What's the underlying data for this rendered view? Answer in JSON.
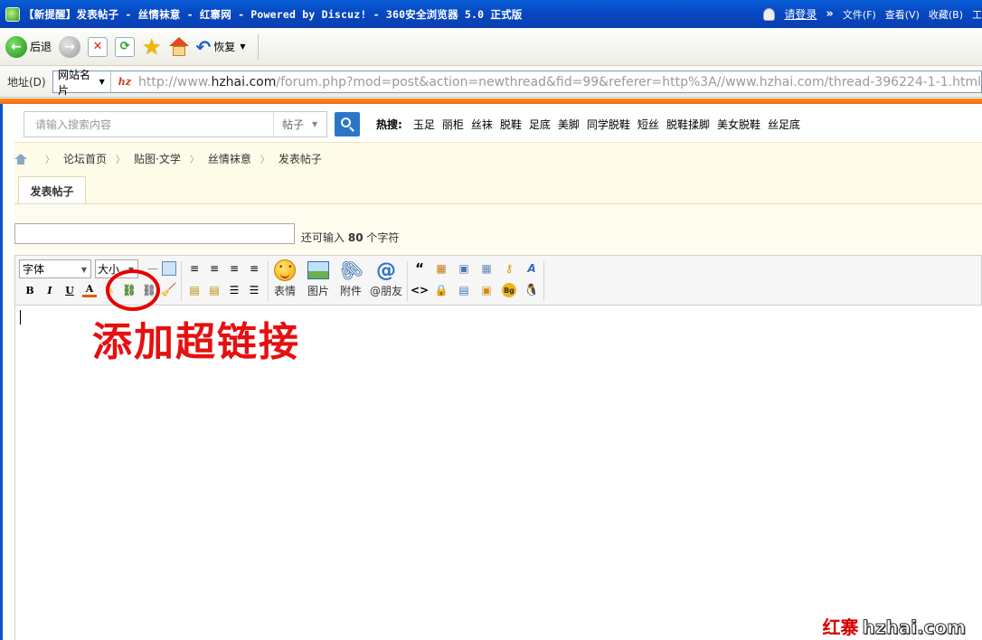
{
  "browser": {
    "title": "【新提醒】发表帖子 - 丝情袜意 - 红寨网 - Powered by Discuz! - 360安全浏览器 5.0 正式版",
    "login_label": "请登录",
    "menus": [
      "文件(F)",
      "查看(V)",
      "收藏(B)",
      "工"
    ]
  },
  "toolbar": {
    "back_label": "后退",
    "restore_label": "恢复"
  },
  "address_bar": {
    "label": "地址(D)",
    "site_dropdown": "网站名片",
    "url_prefix": "http://www.",
    "url_host": "hzhai.com",
    "url_rest": "/forum.php?mod=post&action=newthread&fid=99&referer=http%3A//www.hzhai.com/thread-396224-1-1.html"
  },
  "search": {
    "placeholder": "请输入搜索内容",
    "type": "帖子",
    "hot_label": "热搜:",
    "hot_terms": [
      "玉足",
      "丽柜",
      "丝袜",
      "脱鞋",
      "足底",
      "美脚",
      "同学脱鞋",
      "短丝",
      "脱鞋揉脚",
      "美女脱鞋",
      "丝足底"
    ]
  },
  "breadcrumb": [
    "论坛首页",
    "贴图·文学",
    "丝情袜意",
    "发表帖子"
  ],
  "tab": {
    "label": "发表帖子"
  },
  "subject": {
    "value": "",
    "remain_prefix": "还可输入",
    "remain_count": "80",
    "remain_suffix": "个字符"
  },
  "editor": {
    "font_label": "字体",
    "size_label": "大小",
    "bold": "B",
    "italic": "I",
    "underline": "U",
    "color": "A",
    "emoji_label": "表情",
    "image_label": "图片",
    "attach_label": "附件",
    "mention_label": "@朋友"
  },
  "annotation": {
    "text": "添加超链接",
    "color": "#e61010"
  },
  "watermark": {
    "cn": "红寨",
    "en": "hzhai.com"
  },
  "colors": {
    "accent_orange": "#f46a0c",
    "xp_blue": "#0648c2",
    "search_blue": "#2b75c9"
  }
}
